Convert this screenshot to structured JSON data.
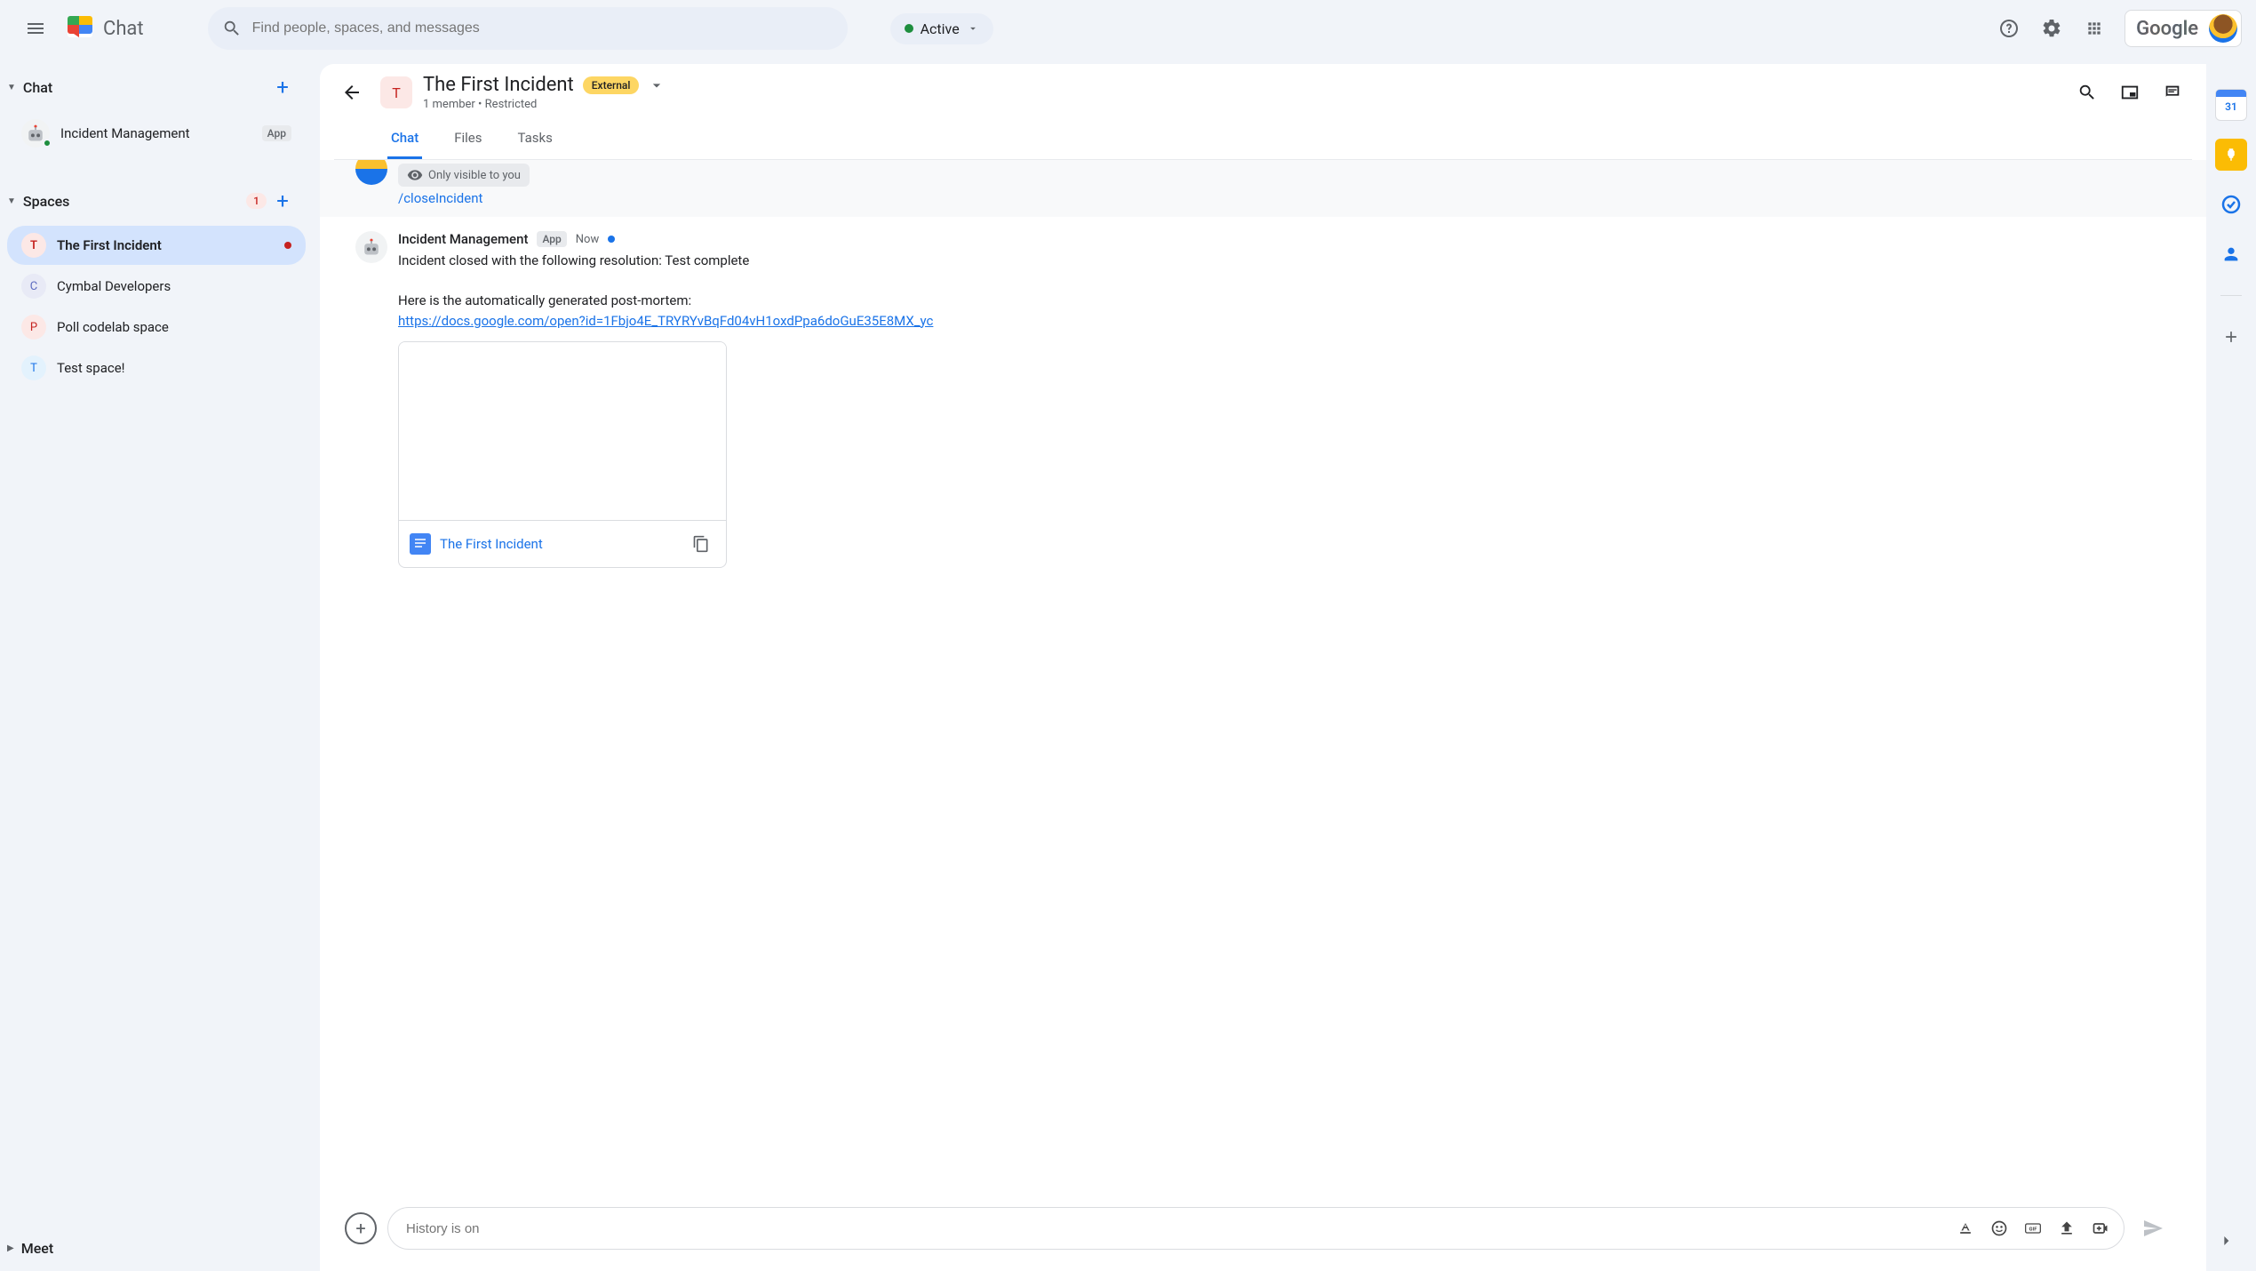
{
  "app": {
    "name": "Chat"
  },
  "search": {
    "placeholder": "Find people, spaces, and messages"
  },
  "status": {
    "label": "Active"
  },
  "google": {
    "label": "Google"
  },
  "sidebar": {
    "chat": {
      "title": "Chat"
    },
    "spaces": {
      "title": "Spaces",
      "count": "1"
    },
    "meet": {
      "title": "Meet"
    },
    "chat_items": [
      {
        "label": "Incident Management",
        "badge": "App"
      }
    ],
    "space_items": [
      {
        "letter": "T",
        "label": "The First Incident",
        "color": "#fce8e6",
        "fg": "#c5221f",
        "active": true,
        "unread": true
      },
      {
        "letter": "C",
        "label": "Cymbal Developers",
        "color": "#e8eaf6",
        "fg": "#5c6bc0"
      },
      {
        "letter": "P",
        "label": "Poll codelab space",
        "color": "#fce8e6",
        "fg": "#c5221f"
      },
      {
        "letter": "T",
        "label": "Test space!",
        "color": "#e3f2fd",
        "fg": "#1a73e8"
      }
    ]
  },
  "space": {
    "letter": "T",
    "title": "The First Incident",
    "external": "External",
    "subtitle": "1 member  •  Restricted",
    "tabs": [
      "Chat",
      "Files",
      "Tasks"
    ]
  },
  "messages": {
    "visibility_note": "Only visible to you",
    "command": "/closeIncident",
    "bot": {
      "author": "Incident Management",
      "badge": "App",
      "time": "Now",
      "line1": "Incident closed with the following resolution: Test complete",
      "line2": "Here is the automatically generated post-mortem:",
      "link": "https://docs.google.com/open?id=1Fbjo4E_TRYRYvBqFd04vH1oxdPpa6doGuE35E8MX_yc"
    },
    "doc": {
      "name": "The First Incident"
    }
  },
  "compose": {
    "placeholder": "History is on"
  },
  "rail": {
    "calendar_day": "31"
  }
}
